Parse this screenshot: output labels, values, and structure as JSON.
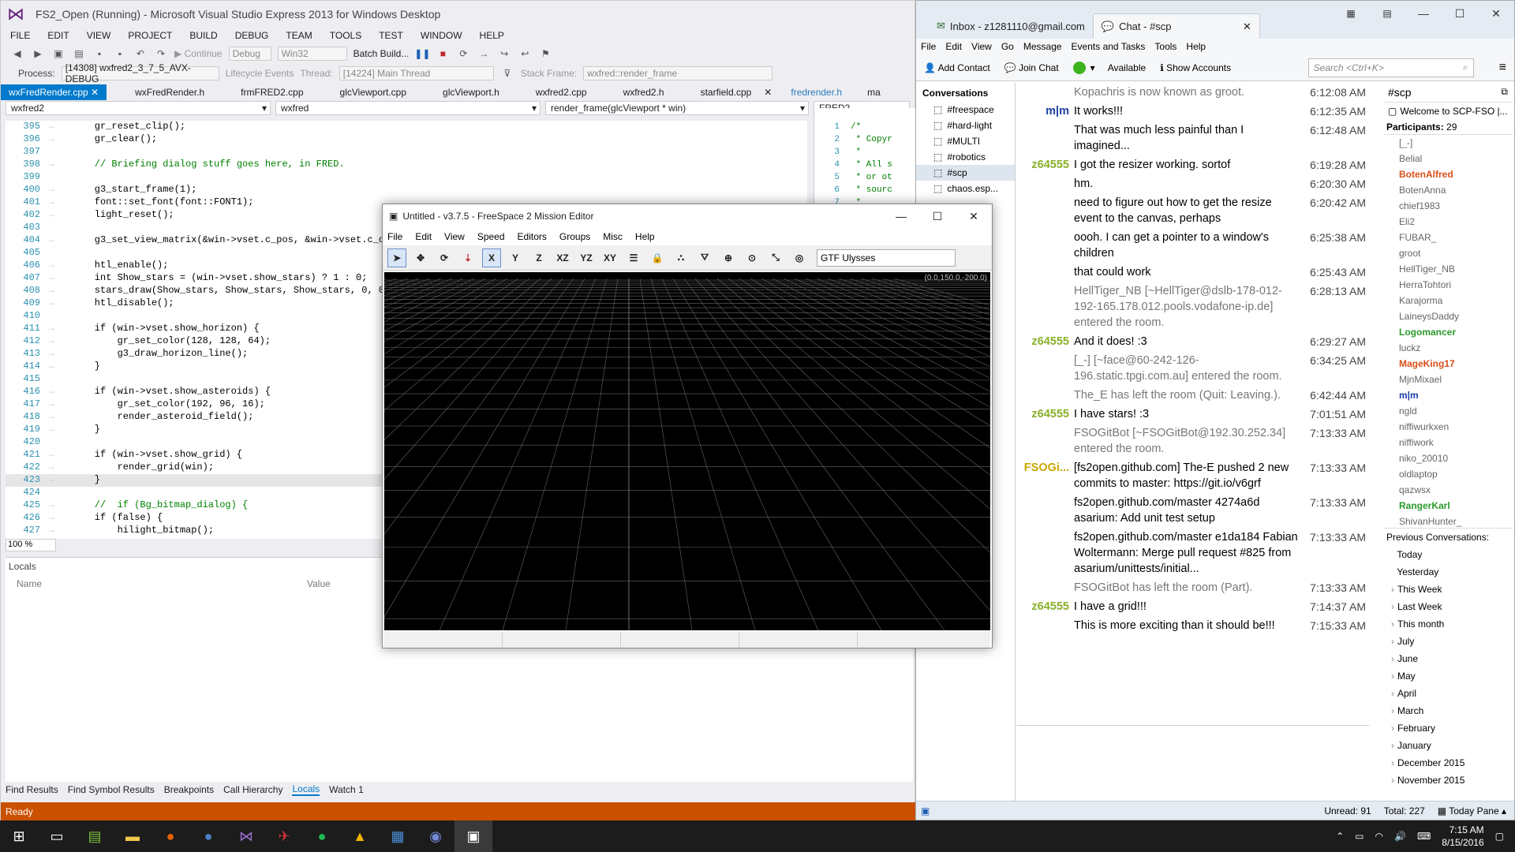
{
  "vs": {
    "title": "FS2_Open (Running) - Microsoft Visual Studio Express 2013 for Windows Desktop",
    "menu": [
      "FILE",
      "EDIT",
      "VIEW",
      "PROJECT",
      "BUILD",
      "DEBUG",
      "TEAM",
      "TOOLS",
      "TEST",
      "WINDOW",
      "HELP"
    ],
    "toolbar": {
      "continue": "Continue",
      "config": "Debug",
      "platform": "Win32",
      "batch": "Batch Build..."
    },
    "process_label": "Process:",
    "process": "[14308] wxfred2_3_7_5_AVX-DEBUG",
    "lifecycle": "Lifecycle Events",
    "thread_label": "Thread:",
    "thread": "[14224] Main Thread",
    "stack_label": "Stack Frame:",
    "stack": "wxfred::render_frame",
    "tabs": [
      "wxFredRender.cpp",
      "wxFredRender.h",
      "frmFRED2.cpp",
      "glcViewport.cpp",
      "glcViewport.h",
      "wxfred2.cpp",
      "wxfred2.h",
      "starfield.cpp"
    ],
    "right_tabs": [
      "fredrender.h",
      "ma"
    ],
    "nav": {
      "scope": "wxfred2",
      "class": "wxfred",
      "member": "render_frame(glcViewport * win)",
      "right": "FRED2"
    },
    "code": [
      {
        "n": "395",
        "t": "    gr_reset_clip();"
      },
      {
        "n": "396",
        "t": "    gr_clear();"
      },
      {
        "n": "397",
        "t": ""
      },
      {
        "n": "398",
        "t": "    // Briefing dialog stuff goes here, in FRED.",
        "c": true
      },
      {
        "n": "399",
        "t": ""
      },
      {
        "n": "400",
        "t": "    g3_start_frame(1);"
      },
      {
        "n": "401",
        "t": "    font::set_font(font::FONT1);"
      },
      {
        "n": "402",
        "t": "    light_reset();"
      },
      {
        "n": "403",
        "t": ""
      },
      {
        "n": "404",
        "t": "    g3_set_view_matrix(&win->vset.c_pos, &win->vset.c_orie"
      },
      {
        "n": "405",
        "t": ""
      },
      {
        "n": "406",
        "t": "    htl_enable();"
      },
      {
        "n": "407",
        "t": "    int Show_stars = (win->vset.show_stars) ? 1 : 0;"
      },
      {
        "n": "408",
        "t": "    stars_draw(Show_stars, Show_stars, Show_stars, 0, 0);"
      },
      {
        "n": "409",
        "t": "    htl_disable();"
      },
      {
        "n": "410",
        "t": ""
      },
      {
        "n": "411",
        "t": "    if (win->vset.show_horizon) {"
      },
      {
        "n": "412",
        "t": "        gr_set_color(128, 128, 64);"
      },
      {
        "n": "413",
        "t": "        g3_draw_horizon_line();"
      },
      {
        "n": "414",
        "t": "    }"
      },
      {
        "n": "415",
        "t": ""
      },
      {
        "n": "416",
        "t": "    if (win->vset.show_asteroids) {"
      },
      {
        "n": "417",
        "t": "        gr_set_color(192, 96, 16);"
      },
      {
        "n": "418",
        "t": "        render_asteroid_field();"
      },
      {
        "n": "419",
        "t": "    }"
      },
      {
        "n": "420",
        "t": ""
      },
      {
        "n": "421",
        "t": "    if (win->vset.show_grid) {"
      },
      {
        "n": "422",
        "t": "        render_grid(win);"
      },
      {
        "n": "423",
        "t": "    }"
      },
      {
        "n": "424",
        "t": ""
      },
      {
        "n": "425",
        "t": "    //  if (Bg_bitmap_dialog) {",
        "c": true
      },
      {
        "n": "426",
        "t": "    if (false) {"
      },
      {
        "n": "427",
        "t": "        hilight_bitmap();"
      }
    ],
    "right_code": [
      {
        "n": "1",
        "t": "/*"
      },
      {
        "n": "2",
        "t": " * Copyr"
      },
      {
        "n": "3",
        "t": " *"
      },
      {
        "n": "4",
        "t": " * All s"
      },
      {
        "n": "5",
        "t": " * or ot"
      },
      {
        "n": "6",
        "t": " * sourc"
      },
      {
        "n": "7",
        "t": " *"
      }
    ],
    "zoom": "100 %",
    "locals_title": "Locals",
    "locals_cols": [
      "Name",
      "Value"
    ],
    "bottom_tabs": [
      "Find Results",
      "Find Symbol Results",
      "Breakpoints",
      "Call Hierarchy",
      "Locals",
      "Watch 1"
    ],
    "status": "Ready",
    "accent": "#007acc",
    "status_color": "#ca5100"
  },
  "fred": {
    "title": "Untitled - v3.7.5 - FreeSpace 2 Mission Editor",
    "menu": [
      "File",
      "Edit",
      "View",
      "Speed",
      "Editors",
      "Groups",
      "Misc",
      "Help"
    ],
    "axis_buttons": [
      "X",
      "Y",
      "Z",
      "XZ",
      "YZ",
      "XY"
    ],
    "ship": "GTF Ulysses",
    "coords": "(0.0,150.0,-200.0)"
  },
  "tb": {
    "tabs": [
      {
        "label": "Inbox - z1281110@gmail.com",
        "icon": "envelope-icon"
      },
      {
        "label": "Chat - #scp",
        "icon": "chat-icon"
      }
    ],
    "menu": [
      "File",
      "Edit",
      "View",
      "Go",
      "Message",
      "Events and Tasks",
      "Tools",
      "Help"
    ],
    "toolbar": {
      "add_contact": "Add Contact",
      "join_chat": "Join Chat",
      "status": "Available",
      "show_accounts": "Show Accounts"
    },
    "search_placeholder": "Search <Ctrl+K>",
    "conversations_title": "Conversations",
    "conversations": [
      "#freespace",
      "#hard-light",
      "#MULTI",
      "#robotics",
      "#scp",
      "chaos.esp..."
    ],
    "chat": [
      {
        "nick": "",
        "body": "Kopachris is now known as groot.",
        "time": "6:12:08 AM",
        "sys": true
      },
      {
        "nick": "m|m",
        "body": "It works!!!",
        "time": "6:12:35 AM",
        "color": "#1b3fa6"
      },
      {
        "nick": "",
        "body": "That was much less painful than I imagined...",
        "time": "6:12:48 AM"
      },
      {
        "nick": "z64555",
        "body": "I got the resizer working. sortof",
        "time": "6:19:28 AM",
        "color": "#8ab02a"
      },
      {
        "nick": "",
        "body": "hm.",
        "time": "6:20:30 AM"
      },
      {
        "nick": "",
        "body": "need to figure out how to get the resize event to the canvas, perhaps",
        "time": "6:20:42 AM"
      },
      {
        "nick": "",
        "body": "oooh. I can get a pointer to a window's children",
        "time": "6:25:38 AM"
      },
      {
        "nick": "",
        "body": "that could work",
        "time": "6:25:43 AM"
      },
      {
        "nick": "",
        "body": "HellTiger_NB [~HellTiger@dslb-178-012-192-165.178.012.pools.vodafone-ip.de] entered the room.",
        "time": "6:28:13 AM",
        "sys": true
      },
      {
        "nick": "z64555",
        "body": "And it does! :3",
        "time": "6:29:27 AM",
        "color": "#8ab02a"
      },
      {
        "nick": "",
        "body": "[_-] [~face@60-242-126-196.static.tpgi.com.au] entered the room.",
        "time": "6:34:25 AM",
        "sys": true
      },
      {
        "nick": "",
        "body": "The_E has left the room (Quit: Leaving.).",
        "time": "6:42:44 AM",
        "sys": true
      },
      {
        "nick": "z64555",
        "body": "I have stars! :3",
        "time": "7:01:51 AM",
        "color": "#8ab02a"
      },
      {
        "nick": "",
        "body": "FSOGitBot [~FSOGitBot@192.30.252.34] entered the room.",
        "time": "7:13:33 AM",
        "sys": true
      },
      {
        "nick": "FSOGi...",
        "body": "[fs2open.github.com] The-E pushed 2 new commits to master: https://git.io/v6grf",
        "time": "7:13:33 AM",
        "color": "#c8a800"
      },
      {
        "nick": "",
        "body": "fs2open.github.com/master 4274a6d asarium: Add unit test setup",
        "time": "7:13:33 AM"
      },
      {
        "nick": "",
        "body": "fs2open.github.com/master e1da184 Fabian Woltermann: Merge pull request #825 from asarium/unittests/initial...",
        "time": "7:13:33 AM"
      },
      {
        "nick": "",
        "body": "FSOGitBot has left the room (Part).",
        "time": "7:13:33 AM",
        "sys": true
      },
      {
        "nick": "z64555",
        "body": "I have a grid!!!",
        "time": "7:14:37 AM",
        "color": "#8ab02a"
      },
      {
        "nick": "",
        "body": "This is more exciting than it should be!!!",
        "time": "7:15:33 AM"
      }
    ],
    "channel": "#scp",
    "topic": "Welcome to SCP-FSO |...",
    "participants_label": "Participants:",
    "participants_count": "29",
    "participants": [
      {
        "n": "[_-]",
        "c": "#666"
      },
      {
        "n": "Belial",
        "c": "#666"
      },
      {
        "n": "BotenAlfred",
        "c": "#d9501b"
      },
      {
        "n": "BotenAnna",
        "c": "#666"
      },
      {
        "n": "chief1983",
        "c": "#666"
      },
      {
        "n": "Eli2",
        "c": "#666"
      },
      {
        "n": "FUBAR_",
        "c": "#666"
      },
      {
        "n": "groot",
        "c": "#666"
      },
      {
        "n": "HellTiger_NB",
        "c": "#666"
      },
      {
        "n": "HerraTohtori",
        "c": "#666"
      },
      {
        "n": "Karajorma",
        "c": "#666"
      },
      {
        "n": "LaineysDaddy",
        "c": "#666"
      },
      {
        "n": "Logomancer",
        "c": "#2a9a2a"
      },
      {
        "n": "luckz",
        "c": "#666"
      },
      {
        "n": "MageKing17",
        "c": "#d9501b"
      },
      {
        "n": "MjnMixael",
        "c": "#666"
      },
      {
        "n": "m|m",
        "c": "#1b3fa6"
      },
      {
        "n": "ngld",
        "c": "#666"
      },
      {
        "n": "niffiwurkxen",
        "c": "#666"
      },
      {
        "n": "niffiwork",
        "c": "#666"
      },
      {
        "n": "niko_20010",
        "c": "#666"
      },
      {
        "n": "oldlaptop",
        "c": "#666"
      },
      {
        "n": "qazwsx",
        "c": "#666"
      },
      {
        "n": "RangerKarl",
        "c": "#2a9a2a"
      },
      {
        "n": "ShivanHunter_",
        "c": "#666"
      }
    ],
    "previous_label": "Previous Conversations:",
    "previous": [
      "Today",
      "Yesterday",
      "This Week",
      "Last Week",
      "This month",
      "July",
      "June",
      "May",
      "April",
      "March",
      "February",
      "January",
      "December 2015",
      "November 2015"
    ],
    "unread": "Unread: 91",
    "total": "Total: 227",
    "today_pane": "Today Pane"
  },
  "taskbar": {
    "time": "7:15 AM",
    "date": "8/15/2016"
  }
}
